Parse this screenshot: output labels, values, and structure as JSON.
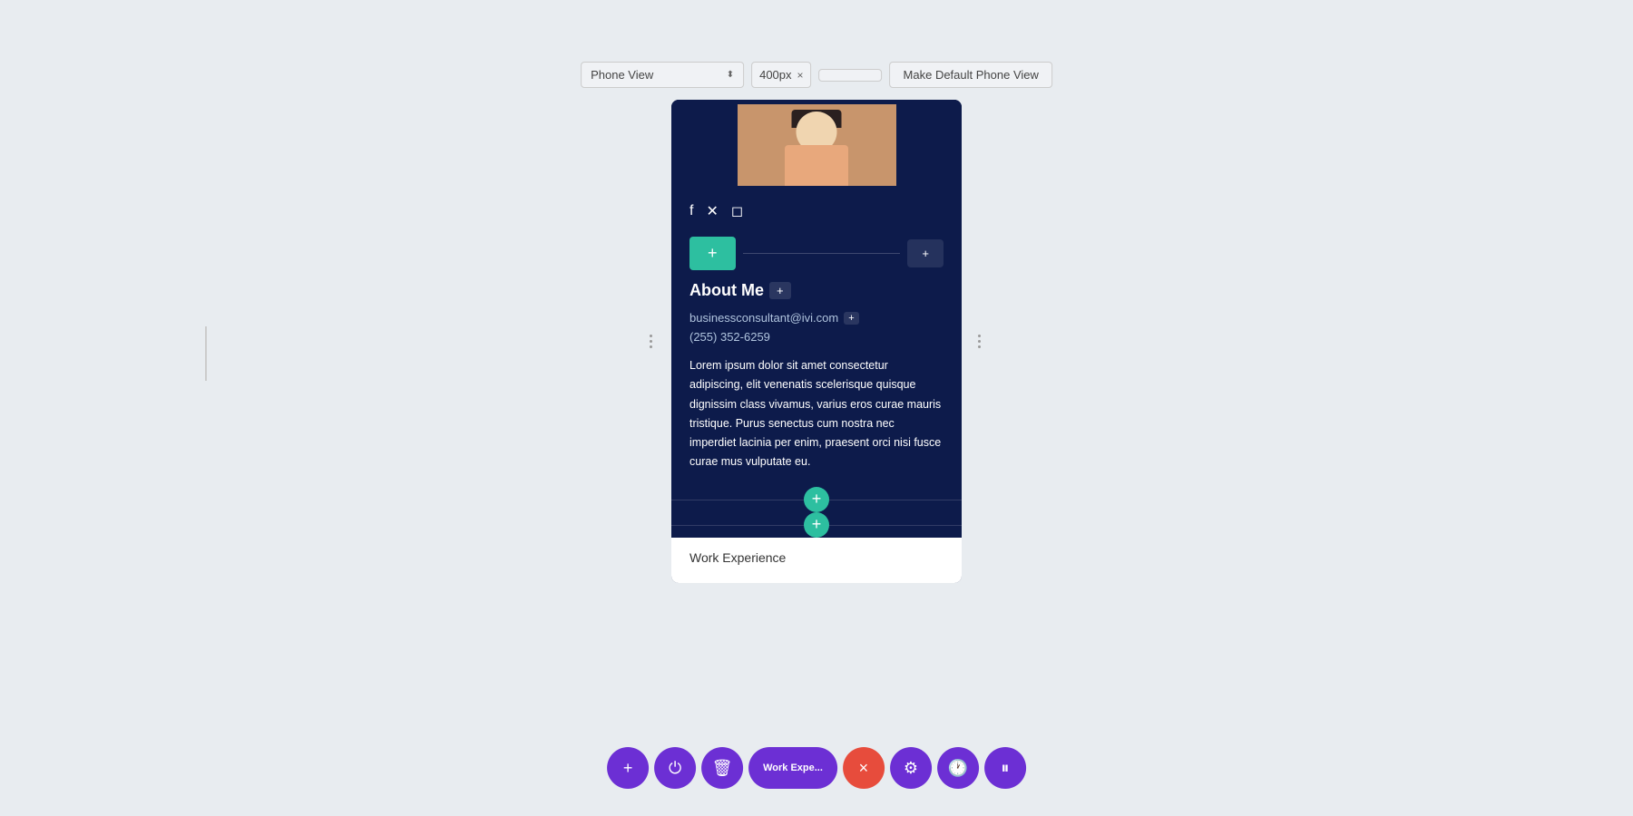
{
  "toolbar": {
    "view_select_label": "Phone View",
    "view_select_chevron": "⬍",
    "px_value": "400px",
    "close_x": "×",
    "extra_placeholder": "",
    "make_default_btn": "Make Default Phone View"
  },
  "phone": {
    "social_icons": [
      "f",
      "𝕏",
      "◻"
    ],
    "add_btn_label": "+",
    "about_title": "About Me",
    "about_plus": "+",
    "email": "businessconsultant@ivi.com",
    "phone": "(255) 352-6259",
    "bio": "Lorem ipsum dolor sit amet consectetur adipiscing, elit venenatis scelerisque quisque dignissim class vivamus, varius eros curae mauris tristique. Purus senectus cum nostra nec imperdiet lacinia per enim, praesent orci nisi fusce curae mus vulputate eu.",
    "mid_add": "+",
    "section_add": "+",
    "bottom_label": "Work Experience"
  },
  "bottom_toolbar": {
    "add_icon": "+",
    "power_icon": "⏻",
    "trash_icon": "🗑",
    "section_label": "Work Expe...",
    "close_icon": "×",
    "gear_icon": "⚙",
    "clock_icon": "🕐",
    "pause_icon": "⏸"
  }
}
